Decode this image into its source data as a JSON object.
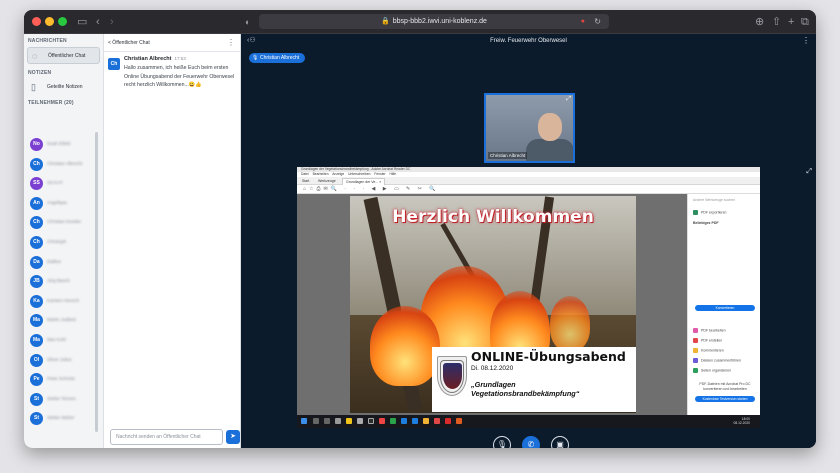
{
  "browser": {
    "url": "bbsp-bbb2.iwvi.uni-koblenz.de"
  },
  "sidebar": {
    "messages_heading": "NACHRICHTEN",
    "public_chat": "Öffentlicher Chat",
    "notes_heading": "NOTIZEN",
    "shared_notes": "Geteilte Notizen",
    "participants_heading": "TEILNEHMER (20)",
    "users": [
      {
        "initials": "No",
        "color": "#7b3fd1",
        "badge": "#e0473e",
        "name": "Noah Eifeld"
      },
      {
        "initials": "Ch",
        "color": "#1b6fd9",
        "badge": "#2bb24c",
        "name": "Christian Albrecht"
      },
      {
        "initials": "SS",
        "color": "#7b3fd1",
        "badge": "#e0473e",
        "name": "SS-KAT"
      },
      {
        "initials": "An",
        "color": "#1b6fd9",
        "badge": "#e0473e",
        "name": "Angelique"
      },
      {
        "initials": "Ch",
        "color": "#1b6fd9",
        "badge": "#e0473e",
        "name": "Christian Kessler"
      },
      {
        "initials": "Ch",
        "color": "#1b6fd9",
        "badge": "#e0473e",
        "name": "Christoph"
      },
      {
        "initials": "Da",
        "color": "#1b6fd9",
        "badge": "#e0473e",
        "name": "Dalibor"
      },
      {
        "initials": "JB",
        "color": "#1b6fd9",
        "badge": "#e0473e",
        "name": "Jörg Bauch"
      },
      {
        "initials": "Ka",
        "color": "#1b6fd9",
        "badge": "#e0473e",
        "name": "Karsten Henrich"
      },
      {
        "initials": "Ma",
        "color": "#1b6fd9",
        "badge": "#e0473e",
        "name": "Martin Jodlack"
      },
      {
        "initials": "Ma",
        "color": "#1b6fd9",
        "badge": "#e0473e",
        "name": "Max Kohl"
      },
      {
        "initials": "Ol",
        "color": "#1b6fd9",
        "badge": "#e0473e",
        "name": "Oliver Julius"
      },
      {
        "initials": "Pe",
        "color": "#1b6fd9",
        "badge": "#e0473e",
        "name": "Peter Schmitz"
      },
      {
        "initials": "St",
        "color": "#1b6fd9",
        "badge": "#e0473e",
        "name": "Stefan Tennes"
      },
      {
        "initials": "St",
        "color": "#1b6fd9",
        "badge": "#e0473e",
        "name": "Stefan Weber"
      }
    ]
  },
  "chat": {
    "back_label": "< Öffentlicher Chat",
    "message": {
      "avatar": "Ch",
      "author": "Christian Albrecht",
      "time": "17:53",
      "line1": "Hallo zusammen, ich heiße Euch beim ersten",
      "line2": "Online Übungsabend der Feuerwehr Oberwesel",
      "line3": "recht herzlich Willkommen...😀👍"
    },
    "input_placeholder": "Nachricht senden an Öffentlicher Chat"
  },
  "main": {
    "title": "Freiw. Feuerwehr Oberwesel",
    "speaker": "Christian Albrecht",
    "webcam_name": "Christian Albrecht"
  },
  "shared": {
    "acrobat_title": "Grundlagen der Vegetationsbrandbekämpfung - Adobe Acrobat Reader DC",
    "menu": "Datei Bearbeiten Anzeige Unterschreiben Fenster Hilfe",
    "tabs": [
      "Start",
      "Werkzeuge",
      "Grundlagen der Ve... ×"
    ],
    "slide_title": "Herzlich Willkommen",
    "headline": "ONLINE-Übungsabend",
    "date": "Di. 08.12.2020",
    "subtitle1": "„Grundlagen",
    "subtitle2": "Vegetationsbrandbekämpfung“",
    "side": {
      "search": "Andere Werkzeuge suchen",
      "export_pdf": "PDF exportieren",
      "export_heading": "Beliebiges PDF",
      "convert": "Konvertieren",
      "edit_pdf": "PDF bearbeiten",
      "create_pdf": "PDF erstellen",
      "comment": "Kommentieren",
      "combine": "Dateien zusammenführen",
      "organize": "Seiten organisieren",
      "promo": "PDF-Dateien mit Acrobat Pro DC konvertieren und bearbeiten",
      "trial": "Kostenlose Testversion starten"
    },
    "clock_time": "18:00",
    "clock_date": "08.12.2020"
  }
}
